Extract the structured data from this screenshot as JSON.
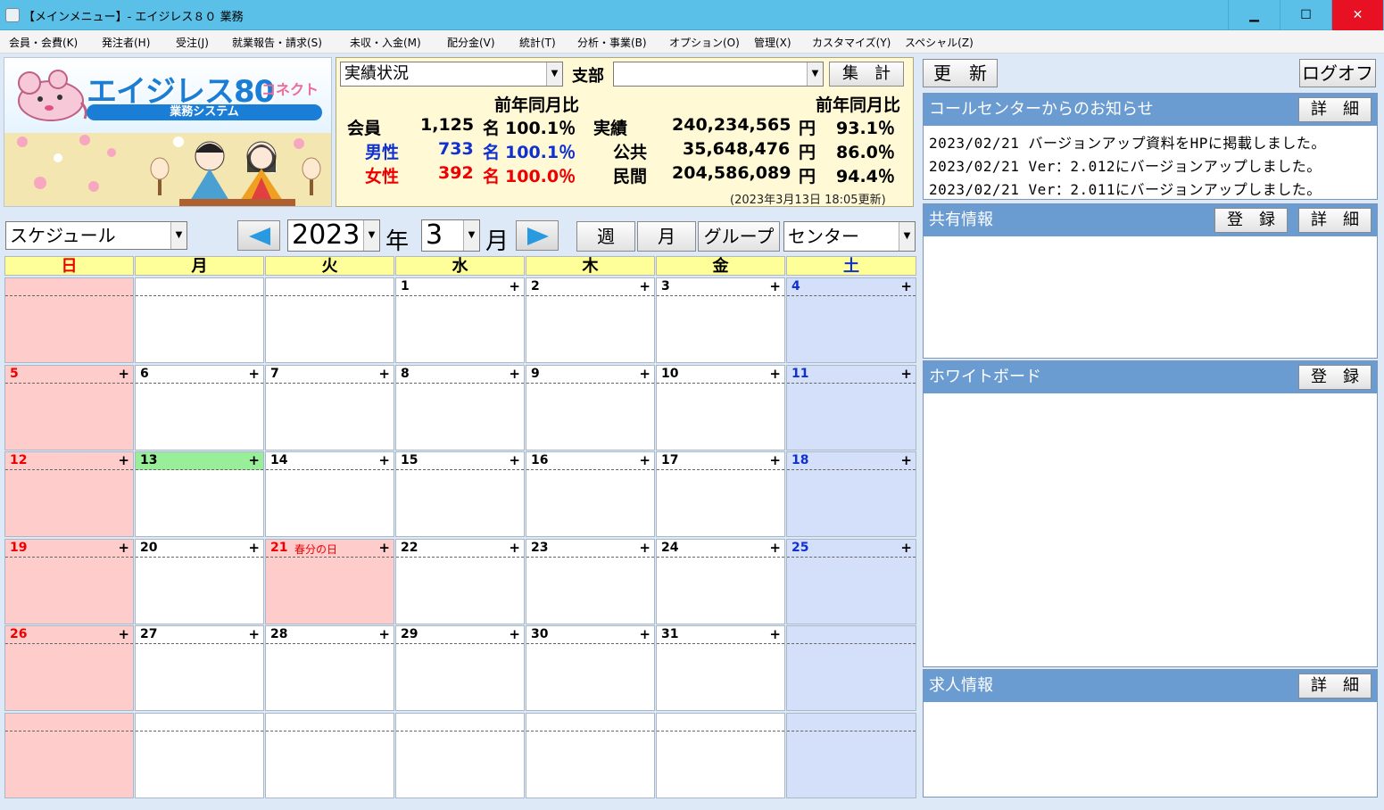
{
  "window": {
    "title": "【メインメニュー】- エイジレス８０ 業務",
    "min_label": "▁",
    "max_label": "☐",
    "close_label": "✕"
  },
  "menu": [
    "会員・会費(K)",
    "発注者(H)",
    "受注(J)",
    "就業報告・請求(S)",
    "未収・入金(M)",
    "配分金(V)",
    "統計(T)",
    "分析・事業(B)",
    "オプション(O)",
    "管理(X)",
    "カスタマイズ(Y)",
    "スペシャル(Z)"
  ],
  "banner": {
    "logo": "エイジレス80",
    "logo_suffix": "コネクト",
    "system": "業務システム"
  },
  "stats": {
    "view_select": "実績状況",
    "branch_label": "支部",
    "branch_value": "",
    "tally_button": "集　計",
    "yoy_header": "前年同月比",
    "members_label": "会員",
    "members_count": "1,125",
    "members_unit": "名",
    "members_pct": "100.1％",
    "male_label": "男性",
    "male_count": "733",
    "male_unit": "名",
    "male_pct": "100.1％",
    "female_label": "女性",
    "female_count": "392",
    "female_unit": "名",
    "female_pct": "100.0％",
    "results_label": "実績",
    "results_amount": "240,234,565",
    "yen": "円",
    "results_pct": "93.1％",
    "public_label": "公共",
    "public_amount": "35,648,476",
    "public_pct": "86.0％",
    "private_label": "民間",
    "private_amount": "204,586,089",
    "private_pct": "94.4％",
    "updated": "(2023年3月13日 18:05更新)"
  },
  "calendar_controls": {
    "mode": "スケジュール",
    "year": "2023",
    "year_unit": "年",
    "month": "3",
    "month_unit": "月",
    "week_button": "週",
    "month_button": "月",
    "group_button": "グループ",
    "center_select": "センター"
  },
  "weekdays": [
    "日",
    "月",
    "火",
    "水",
    "木",
    "金",
    "土"
  ],
  "weeks": [
    [
      {
        "d": "",
        "p": false
      },
      {
        "d": "",
        "p": false
      },
      {
        "d": "",
        "p": false
      },
      {
        "d": "1",
        "p": true
      },
      {
        "d": "2",
        "p": true
      },
      {
        "d": "3",
        "p": true
      },
      {
        "d": "4",
        "p": true
      }
    ],
    [
      {
        "d": "5",
        "p": true
      },
      {
        "d": "6",
        "p": true
      },
      {
        "d": "7",
        "p": true
      },
      {
        "d": "8",
        "p": true
      },
      {
        "d": "9",
        "p": true
      },
      {
        "d": "10",
        "p": true
      },
      {
        "d": "11",
        "p": true
      }
    ],
    [
      {
        "d": "12",
        "p": true
      },
      {
        "d": "13",
        "p": true,
        "today": true
      },
      {
        "d": "14",
        "p": true
      },
      {
        "d": "15",
        "p": true
      },
      {
        "d": "16",
        "p": true
      },
      {
        "d": "17",
        "p": true
      },
      {
        "d": "18",
        "p": true
      }
    ],
    [
      {
        "d": "19",
        "p": true
      },
      {
        "d": "20",
        "p": true
      },
      {
        "d": "21",
        "p": true,
        "holiday": "春分の日"
      },
      {
        "d": "22",
        "p": true
      },
      {
        "d": "23",
        "p": true
      },
      {
        "d": "24",
        "p": true
      },
      {
        "d": "25",
        "p": true
      }
    ],
    [
      {
        "d": "26",
        "p": true
      },
      {
        "d": "27",
        "p": true
      },
      {
        "d": "28",
        "p": true
      },
      {
        "d": "29",
        "p": true
      },
      {
        "d": "30",
        "p": true
      },
      {
        "d": "31",
        "p": true
      },
      {
        "d": "",
        "p": false
      }
    ],
    [
      {
        "d": "",
        "p": false
      },
      {
        "d": "",
        "p": false
      },
      {
        "d": "",
        "p": false
      },
      {
        "d": "",
        "p": false
      },
      {
        "d": "",
        "p": false
      },
      {
        "d": "",
        "p": false
      },
      {
        "d": "",
        "p": false
      }
    ]
  ],
  "plus_label": "+",
  "right": {
    "refresh": "更　新",
    "logoff": "ログオフ",
    "callcenter_title": "コールセンターからのお知らせ",
    "detail": "詳　細",
    "register": "登　録",
    "notices": [
      "2023/02/21 バージョンアップ資料をHPに掲載しました。",
      "2023/02/21 Ver：2.012にバージョンアップしました。",
      "2023/02/21 Ver：2.011にバージョンアップしました。"
    ],
    "shared_title": "共有情報",
    "whiteboard_title": "ホワイトボード",
    "jobs_title": "求人情報"
  },
  "colors": {
    "titlebar": "#5bc0e8",
    "panel_header": "#6a9bd1",
    "sunday": "#ffcccc",
    "saturday": "#d4e0fa",
    "today": "#99ee99",
    "weekday_header": "#ffff99"
  }
}
